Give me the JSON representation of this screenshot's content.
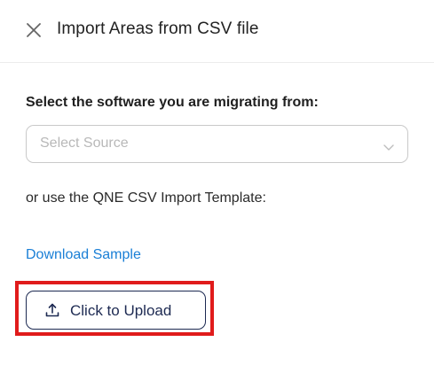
{
  "header": {
    "close_icon": "close-icon",
    "title": "Import Areas from CSV file"
  },
  "source": {
    "label": "Select the software you are migrating from:",
    "placeholder": "Select Source",
    "chevron_icon": "chevron-down-icon"
  },
  "template": {
    "text": "or use the QNE CSV Import Template:",
    "download_label": "Download Sample"
  },
  "upload": {
    "icon": "upload-icon",
    "label": "Click to Upload",
    "highlight_color": "#e01b1b"
  },
  "colors": {
    "link": "#1a7fd6",
    "button_border": "#1d2a52"
  }
}
